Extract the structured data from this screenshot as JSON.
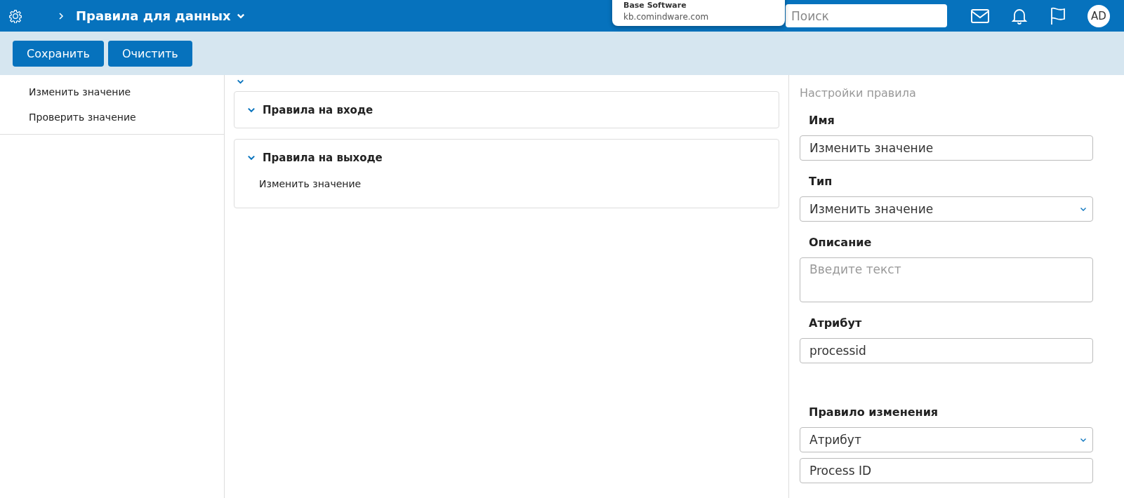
{
  "header": {
    "title": "Правила для данных",
    "popup": {
      "title": "Base Software",
      "url": "kb.comindware.com"
    },
    "search": {
      "placeholder": "Поиск"
    },
    "avatar": "AD"
  },
  "toolbar": {
    "buttons": [
      "Сохранить",
      "Очистить"
    ]
  },
  "sidebar": {
    "items": [
      "Изменить значение",
      "Проверить значение"
    ]
  },
  "groups": [
    {
      "title": "Правила на входе",
      "expanded": true
    },
    {
      "title": "Правила на выходе",
      "expanded": true,
      "items": [
        "Изменить значение"
      ]
    }
  ],
  "settings": {
    "title": "Настройки правила",
    "fields": [
      {
        "kind": "input",
        "label": "Имя",
        "value": "Изменить значение"
      },
      {
        "kind": "select",
        "label": "Тип",
        "value": "Изменить значение"
      },
      {
        "kind": "textarea",
        "label": "Описание",
        "placeholder": "Введите текст"
      },
      {
        "kind": "input",
        "label": "Атрибут",
        "value": "processid"
      },
      {
        "kind": "select",
        "label": "Правило изменения",
        "value": "Атрибут",
        "spaced": true
      },
      {
        "kind": "input",
        "value": "Process ID"
      }
    ]
  }
}
